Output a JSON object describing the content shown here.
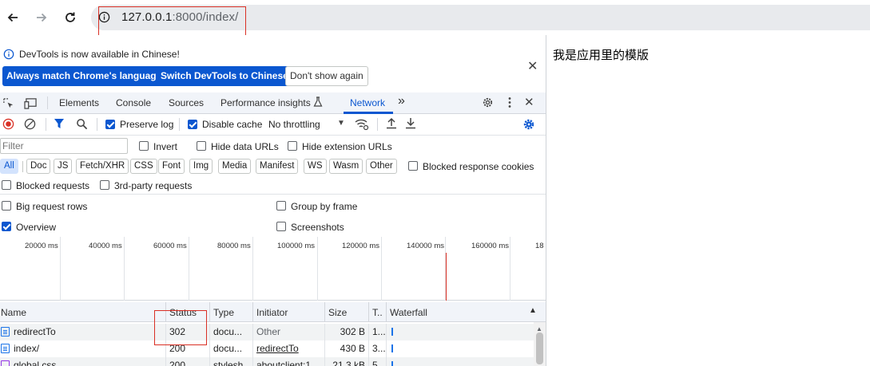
{
  "browser": {
    "url_host": "127.0.0.1",
    "url_rest": ":8000/index/",
    "back_icon": "arrow-left-icon",
    "forward_icon": "arrow-right-icon",
    "reload_icon": "reload-icon",
    "info_icon": "info-icon"
  },
  "page": {
    "text": "我是应用里的模版"
  },
  "banner": {
    "message": "DevTools is now available in Chinese!",
    "btn_match": "Always match Chrome's language",
    "btn_switch": "Switch DevTools to Chinese",
    "btn_dont": "Don't show again"
  },
  "tabs": {
    "elements": "Elements",
    "console": "Console",
    "sources": "Sources",
    "performance": "Performance insights",
    "network": "Network",
    "more": "»"
  },
  "toolbar": {
    "preserve_log": "Preserve log",
    "disable_cache": "Disable cache",
    "throttling": "No throttling"
  },
  "filter": {
    "placeholder": "Filter",
    "invert": "Invert",
    "hide_data": "Hide data URLs",
    "hide_ext": "Hide extension URLs",
    "chips": [
      "All",
      "Doc",
      "JS",
      "Fetch/XHR",
      "CSS",
      "Font",
      "Img",
      "Media",
      "Manifest",
      "WS",
      "Wasm",
      "Other"
    ],
    "blocked_cookies": "Blocked response cookies",
    "blocked_requests": "Blocked requests",
    "third_party": "3rd-party requests"
  },
  "settings": {
    "big_rows": "Big request rows",
    "group_frame": "Group by frame",
    "overview": "Overview",
    "screenshots": "Screenshots"
  },
  "overview": {
    "ticks": [
      "20000 ms",
      "40000 ms",
      "60000 ms",
      "80000 ms",
      "100000 ms",
      "120000 ms",
      "140000 ms",
      "160000 ms",
      "18"
    ]
  },
  "table": {
    "headers": {
      "name": "Name",
      "status": "Status",
      "type": "Type",
      "initiator": "Initiator",
      "size": "Size",
      "time": "T..",
      "waterfall": "Waterfall"
    },
    "rows": [
      {
        "name": "redirectTo",
        "status": "302",
        "type": "docu...",
        "initiator": "Other",
        "size": "302 B",
        "time": "1..."
      },
      {
        "name": "index/",
        "status": "200",
        "type": "docu...",
        "initiator": "redirectTo",
        "size": "430 B",
        "time": "3..."
      },
      {
        "name": "global.css",
        "status": "200",
        "type": "stylesh...",
        "initiator": "aboutclient:1",
        "size": "21.3 kB",
        "time": "5..."
      }
    ]
  },
  "colors": {
    "accent": "#0b57d0",
    "annotation": "#d93025"
  }
}
